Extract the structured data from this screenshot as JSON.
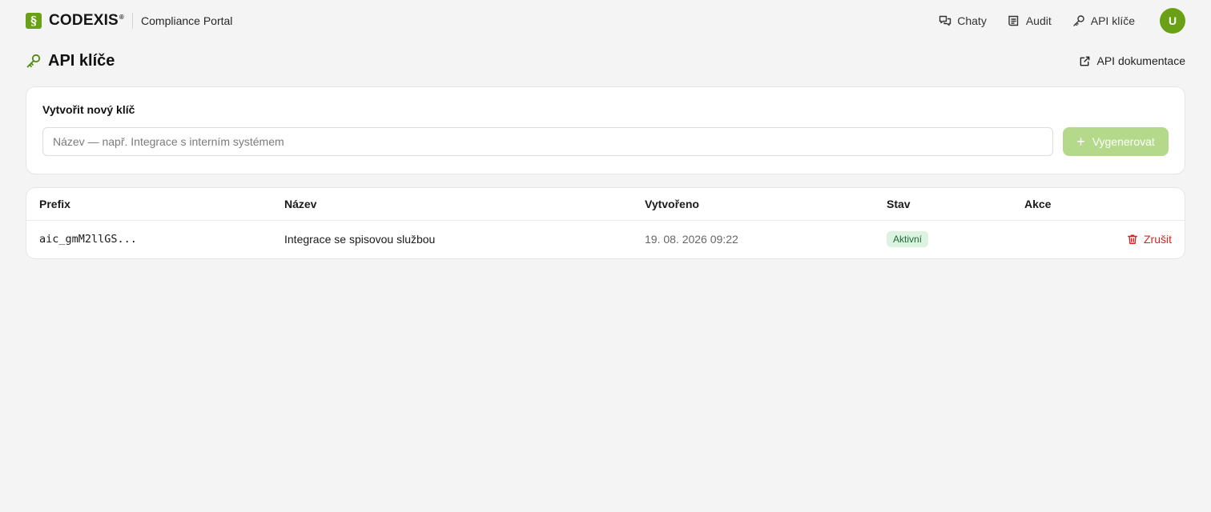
{
  "header": {
    "brand_name": "CODEXIS",
    "brand_reg": "®",
    "brand_logo": "§",
    "subtitle": "Compliance Portal",
    "nav": [
      {
        "label": "Chaty",
        "icon": "chat-icon"
      },
      {
        "label": "Audit",
        "icon": "audit-icon"
      },
      {
        "label": "API klíče",
        "icon": "key-icon"
      }
    ],
    "avatar_initial": "U"
  },
  "page": {
    "title": "API klíče",
    "title_icon": "key-icon",
    "doc_link_label": "API dokumentace",
    "doc_link_icon": "external-link-icon"
  },
  "create": {
    "title": "Vytvořit nový klíč",
    "input_placeholder": "Název — např. Integrace s interním systémem",
    "input_value": "",
    "button_label": "Vygenerovat"
  },
  "table": {
    "headers": {
      "prefix": "Prefix",
      "name": "Název",
      "created": "Vytvořeno",
      "status": "Stav",
      "actions": "Akce"
    },
    "rows": [
      {
        "prefix": "aic_gmM2llGS...",
        "name": "Integrace se spisovou službou",
        "created": "19. 08. 2026 09:22",
        "status": "Aktivní",
        "action": "Zrušit"
      }
    ]
  },
  "colors": {
    "brand": "#6aa016",
    "button_disabled": "#b4d98a",
    "badge_bg": "#dcf3e1",
    "badge_text": "#1d6b34",
    "danger": "#d92323",
    "background": "#f4f4f4"
  }
}
